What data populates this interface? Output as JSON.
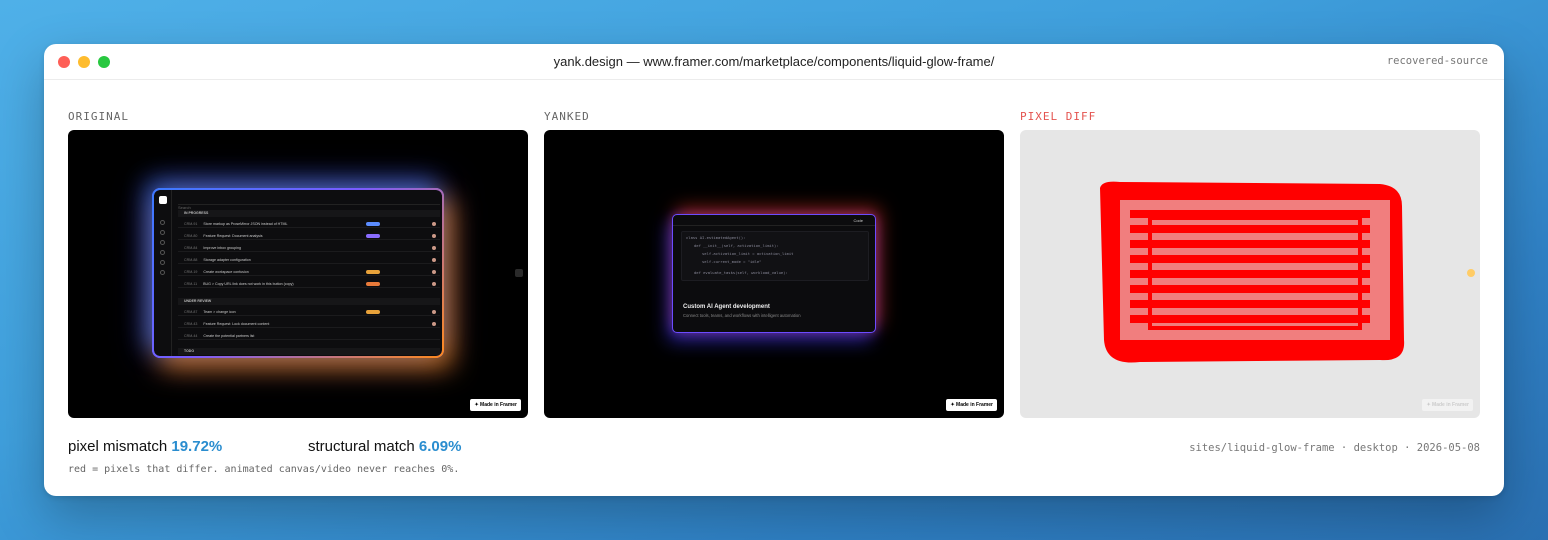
{
  "window": {
    "title": "yank.design — www.framer.com/marketplace/components/liquid-glow-frame/",
    "tag": "recovered-source"
  },
  "panels": {
    "original": {
      "label": "ORIGINAL",
      "badge": "Made in Framer",
      "app": {
        "search_placeholder": "Search",
        "section_in_progress": "IN PROGRESS",
        "section_under_review": "UNDER REVIEW",
        "section_todo": "TODO",
        "rows_in_progress": [
          {
            "id": "CRM-91",
            "title": "Store markup as ProseMirror JSON instead of HTML"
          },
          {
            "id": "CRM-80",
            "title": "Feature Request: Document analysis"
          },
          {
            "id": "CRM-84",
            "title": "Improve inbox grouping"
          },
          {
            "id": "CRM-88",
            "title": "Storage adapter configuration"
          },
          {
            "id": "CRM-19",
            "title": "Create workspace confusion"
          },
          {
            "id": "CRM-11",
            "title": "BUG > Copy URL link does not work in this button (copy)"
          }
        ],
        "rows_under_review": [
          {
            "id": "CRM-87",
            "title": "Team > change icon"
          },
          {
            "id": "CRM-43",
            "title": "Feature Request: Lock document content"
          },
          {
            "id": "CRM-44",
            "title": "Create the potential partners list"
          }
        ]
      }
    },
    "yanked": {
      "label": "YANKED",
      "badge": "Made in Framer",
      "code_button": "Code",
      "code_lines": [
        "class AI.estimatedAgent():",
        "def __init__(self, activation_limit):",
        "self.activation_limit = activation_limit",
        "self.current_mode = \"idle\"",
        "def evaluate_tasks(self, workload_value):"
      ],
      "card_title": "Custom AI Agent development",
      "card_subtitle": "Connect tools, teams, and workflows with intelligent automation"
    },
    "diff": {
      "label": "PIXEL DIFF",
      "badge": "Made in Framer",
      "highlight_color": "#ff0000"
    }
  },
  "stats": {
    "pixel_mismatch_label": "pixel mismatch",
    "pixel_mismatch_value": "19.72%",
    "structural_match_label": "structural match",
    "structural_match_value": "6.09%",
    "note": "red = pixels that differ. animated canvas/video never reaches 0%.",
    "meta": "sites/liquid-glow-frame · desktop · 2026-05-08"
  }
}
